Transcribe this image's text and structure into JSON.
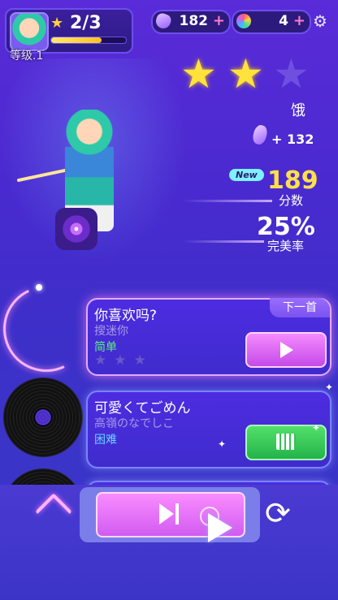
{
  "player": {
    "stage_progress": "2/3",
    "stage_progress_fraction": 0.67,
    "level": "等级.1"
  },
  "currencies": {
    "gems": "182",
    "coins": "4",
    "plus": "+"
  },
  "result": {
    "stars_earned": 2,
    "stars_total": 3,
    "mood": "饿",
    "gem_reward": "+ 132",
    "new_badge": "New",
    "score": "189",
    "score_label": "分数",
    "perfect": "25%",
    "perfect_label": "完美率"
  },
  "songs": [
    {
      "title": "你喜欢吗?",
      "artist": "搜迷你",
      "difficulty": "简单",
      "stars": "★★★",
      "tag": "下一首",
      "action": "play-icon"
    },
    {
      "title": "可愛くてごめん",
      "artist": "高嶺のなでしこ",
      "difficulty": "困难",
      "action": "video-icon"
    }
  ],
  "icons": {
    "star": "★",
    "gear": "⚙",
    "repeat": "⟳"
  },
  "colors": {
    "background": "#4a2ad0",
    "accent_pink": "#f58aff",
    "score_yellow": "#ffe04a",
    "easy_green": "#5cf07a",
    "hard_blue": "#66d4ff"
  }
}
